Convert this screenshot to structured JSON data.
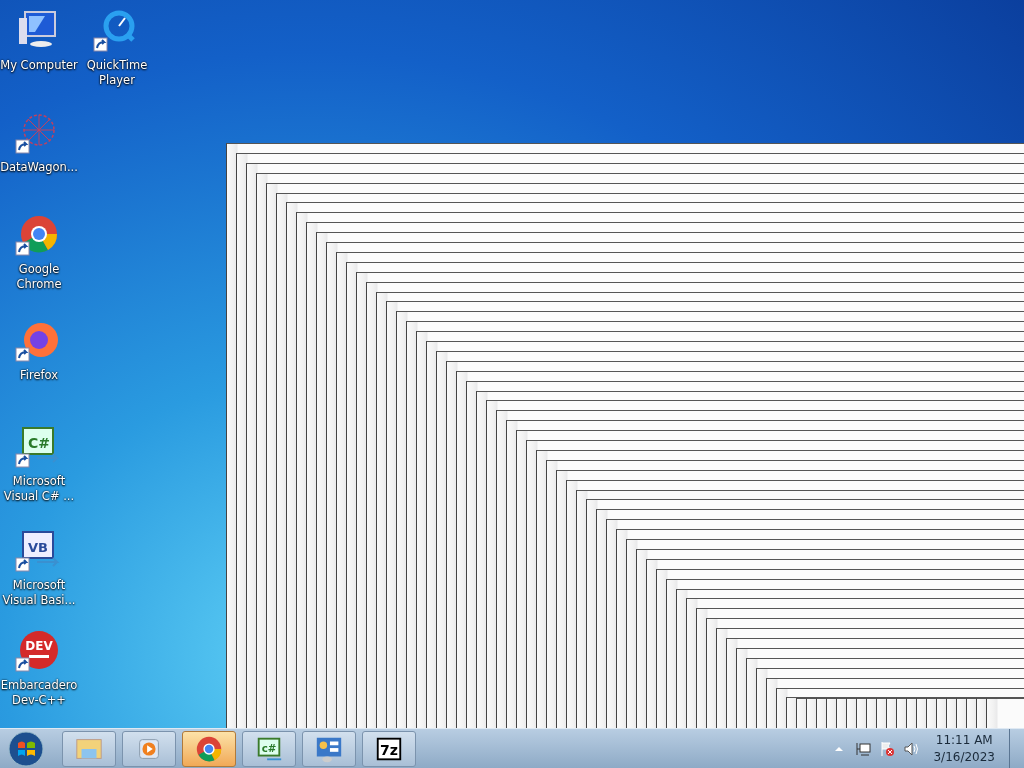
{
  "desktop_icons": [
    {
      "label": "My Computer",
      "kind": "computer"
    },
    {
      "label": "QuickTime Player",
      "kind": "quicktime"
    },
    {
      "label": "DataWagon...",
      "kind": "datawagon"
    },
    {
      "label": "Google Chrome",
      "kind": "chrome"
    },
    {
      "label": "Firefox",
      "kind": "firefox"
    },
    {
      "label": "Microsoft Visual C# ...",
      "kind": "csharp",
      "icon_text": "C#"
    },
    {
      "label": "Microsoft Visual Basi...",
      "kind": "vb",
      "icon_text": "VB"
    },
    {
      "label": "Embarcadero Dev-C++",
      "kind": "devcpp",
      "icon_text": "DEV"
    }
  ],
  "taskbar": {
    "items": [
      {
        "kind": "explorer",
        "selected": false
      },
      {
        "kind": "media",
        "selected": false
      },
      {
        "kind": "chrome",
        "selected": true
      },
      {
        "kind": "csharp",
        "selected": false,
        "icon_text": "c#"
      },
      {
        "kind": "control",
        "selected": false
      },
      {
        "kind": "sevenzip",
        "selected": false,
        "icon_text": "7z"
      }
    ],
    "clock": {
      "time": "11:11 AM",
      "date": "3/16/2023"
    }
  }
}
